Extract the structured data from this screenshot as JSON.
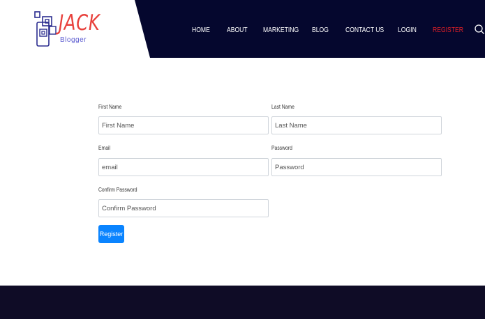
{
  "brand": {
    "title": "JACK",
    "subtitle": "Blogger",
    "logo_icon": "stacked-squares-logo"
  },
  "nav": {
    "items": [
      {
        "label": "HOME",
        "name": "nav-item-home"
      },
      {
        "label": "ABOUT",
        "name": "nav-item-about"
      },
      {
        "label": "MARKETING",
        "name": "nav-item-marketing"
      },
      {
        "label": "BLOG",
        "name": "nav-item-blog"
      },
      {
        "label": "CONTACT US",
        "name": "nav-item-contact-us"
      },
      {
        "label": "LOGIN",
        "name": "nav-item-login"
      },
      {
        "label": "REGISTER",
        "name": "nav-item-register"
      }
    ],
    "search_icon": "search-icon"
  },
  "form": {
    "first_name": {
      "label": "First Name",
      "placeholder": "First Name",
      "value": ""
    },
    "last_name": {
      "label": "Last Name",
      "placeholder": "Last Name",
      "value": ""
    },
    "email": {
      "label": "Email",
      "placeholder": "email",
      "value": ""
    },
    "password": {
      "label": "Password",
      "placeholder": "Password",
      "value": ""
    },
    "confirm_password": {
      "label": "Confirm Password",
      "placeholder": "Confirm Password",
      "value": ""
    },
    "submit_label": "Register"
  },
  "colors": {
    "header_bg": "#05072e",
    "brand_red": "#e8413c",
    "register_link": "#e21f26",
    "button_blue": "#0a84ff",
    "footer_bg": "#0f0c26"
  }
}
